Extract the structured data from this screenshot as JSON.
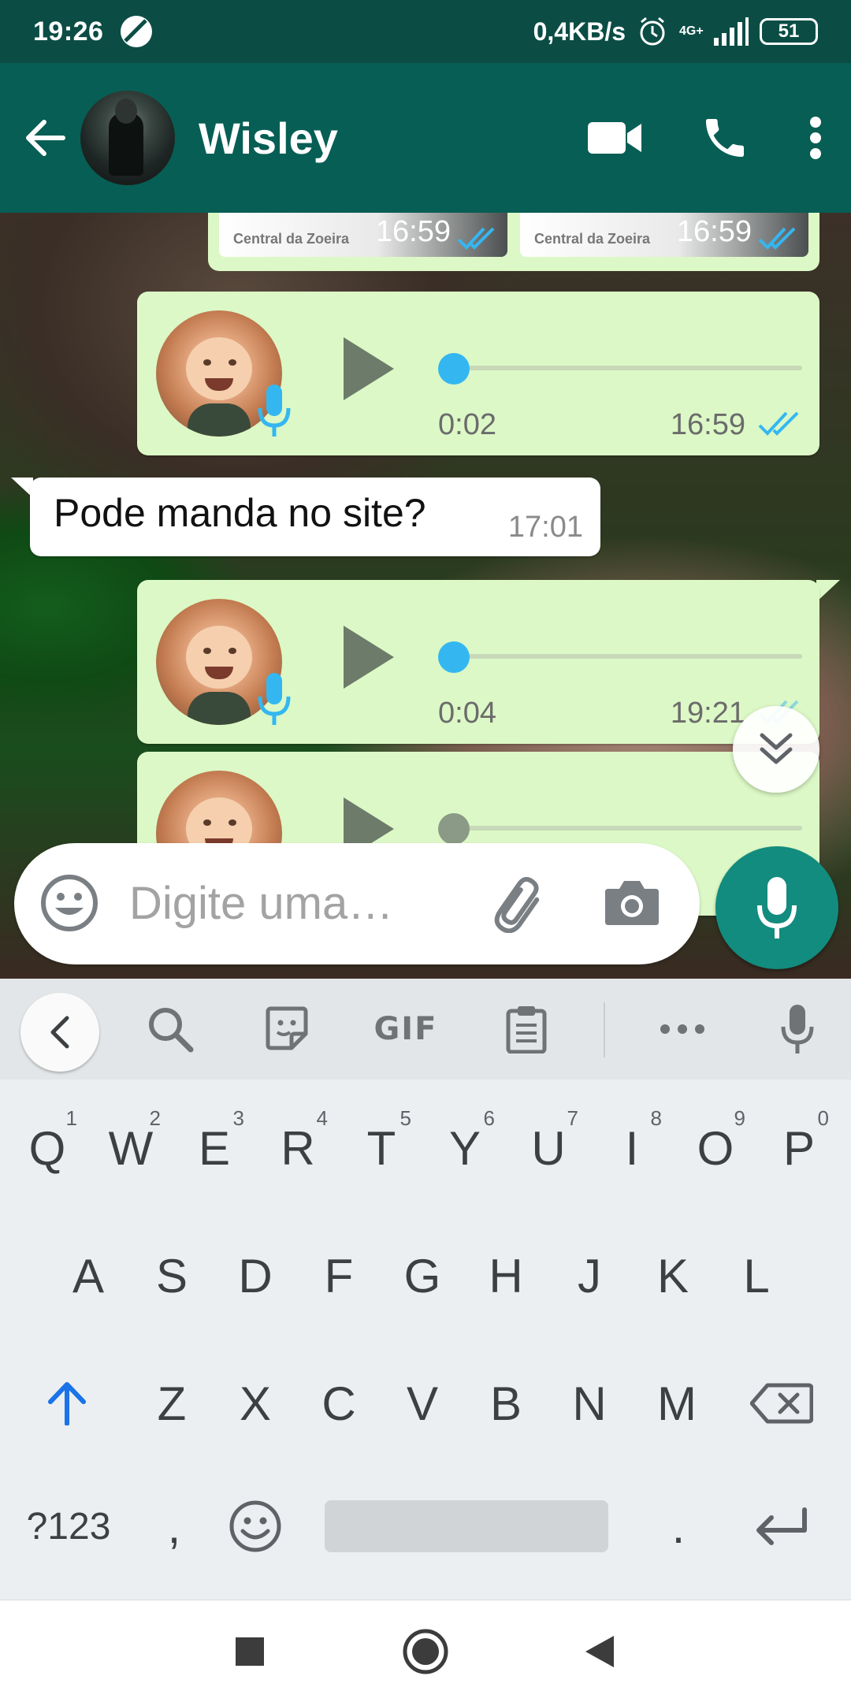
{
  "status_bar": {
    "time": "19:26",
    "network_speed": "0,4KB/s",
    "network_type": "4G+",
    "battery": "51"
  },
  "toolbar": {
    "contact_name": "Wisley"
  },
  "chat": {
    "thumbnails": [
      {
        "source": "Central da Zoeira",
        "time": "16:59"
      },
      {
        "source": "Central da Zoeira",
        "time": "16:59"
      }
    ],
    "voice_messages": [
      {
        "duration": "0:02",
        "time": "16:59"
      },
      {
        "duration": "0:04",
        "time": "19:21"
      }
    ],
    "incoming": {
      "text": "Pode manda no site?",
      "time": "17:01"
    }
  },
  "composer": {
    "placeholder": "Digite uma…"
  },
  "keyboard": {
    "toolbar": {
      "gif": "GIF"
    },
    "row1": [
      "Q",
      "W",
      "E",
      "R",
      "T",
      "Y",
      "U",
      "I",
      "O",
      "P"
    ],
    "row1_hints": [
      "1",
      "2",
      "3",
      "4",
      "5",
      "6",
      "7",
      "8",
      "9",
      "0"
    ],
    "row2": [
      "A",
      "S",
      "D",
      "F",
      "G",
      "H",
      "J",
      "K",
      "L"
    ],
    "row3": [
      "Z",
      "X",
      "C",
      "V",
      "B",
      "N",
      "M"
    ],
    "symbols": "?123",
    "comma": ",",
    "period": "."
  },
  "colors": {
    "status_bar": "#0b4d45",
    "header": "#075e54",
    "outgoing_bubble": "#dcf8c6",
    "accent_blue": "#34b7f1",
    "mic_button": "#128c7e"
  },
  "icons": [
    "moon-icon",
    "alarm-icon",
    "signal-icon",
    "back-arrow-icon",
    "video-call-icon",
    "phone-icon",
    "more-vert-icon",
    "play-icon",
    "mic-icon",
    "read-ticks-icon",
    "double-chevron-down-icon",
    "emoji-icon",
    "paperclip-icon",
    "camera-icon",
    "chevron-left-icon",
    "search-icon",
    "sticker-icon",
    "clipboard-icon",
    "more-horiz-icon",
    "shift-icon",
    "backspace-icon",
    "enter-icon",
    "nav-square-icon",
    "nav-home-icon",
    "nav-back-icon"
  ]
}
